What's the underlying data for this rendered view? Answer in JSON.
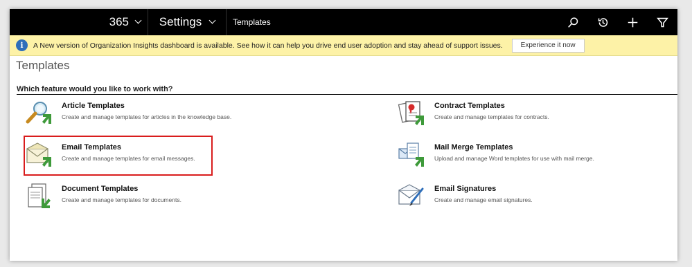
{
  "topbar": {
    "app_name": "365",
    "area": "Settings",
    "breadcrumb": "Templates",
    "icons": [
      "search-icon",
      "recent-icon",
      "new-icon",
      "filter-icon"
    ]
  },
  "notification": {
    "message": "A New version of Organization Insights dashboard is available. See how it can help you drive end user adoption and stay ahead of support issues.",
    "button": "Experience it now",
    "icon": "info-icon"
  },
  "page": {
    "title": "Templates",
    "section_heading": "Which feature would you like to work with?"
  },
  "features": [
    {
      "title": "Article Templates",
      "description": "Create and manage templates for articles in the knowledge base.",
      "icon": "article-templates-icon"
    },
    {
      "title": "Contract Templates",
      "description": "Create and manage templates for contracts.",
      "icon": "contract-templates-icon"
    },
    {
      "title": "Email Templates",
      "description": "Create and manage templates for email messages.",
      "icon": "email-templates-icon"
    },
    {
      "title": "Mail Merge Templates",
      "description": "Upload and manage Word templates for use with mail merge.",
      "icon": "mail-merge-templates-icon"
    },
    {
      "title": "Document Templates",
      "description": "Create and manage templates for documents.",
      "icon": "document-templates-icon"
    },
    {
      "title": "Email Signatures",
      "description": "Create and manage email signatures.",
      "icon": "email-signatures-icon"
    }
  ],
  "colors": {
    "topbar": "#000000",
    "notification_bg": "#fdf2a7",
    "info_icon": "#2f6fba",
    "highlight_border": "#d91c1c",
    "icon_green": "#3e9a3a"
  }
}
